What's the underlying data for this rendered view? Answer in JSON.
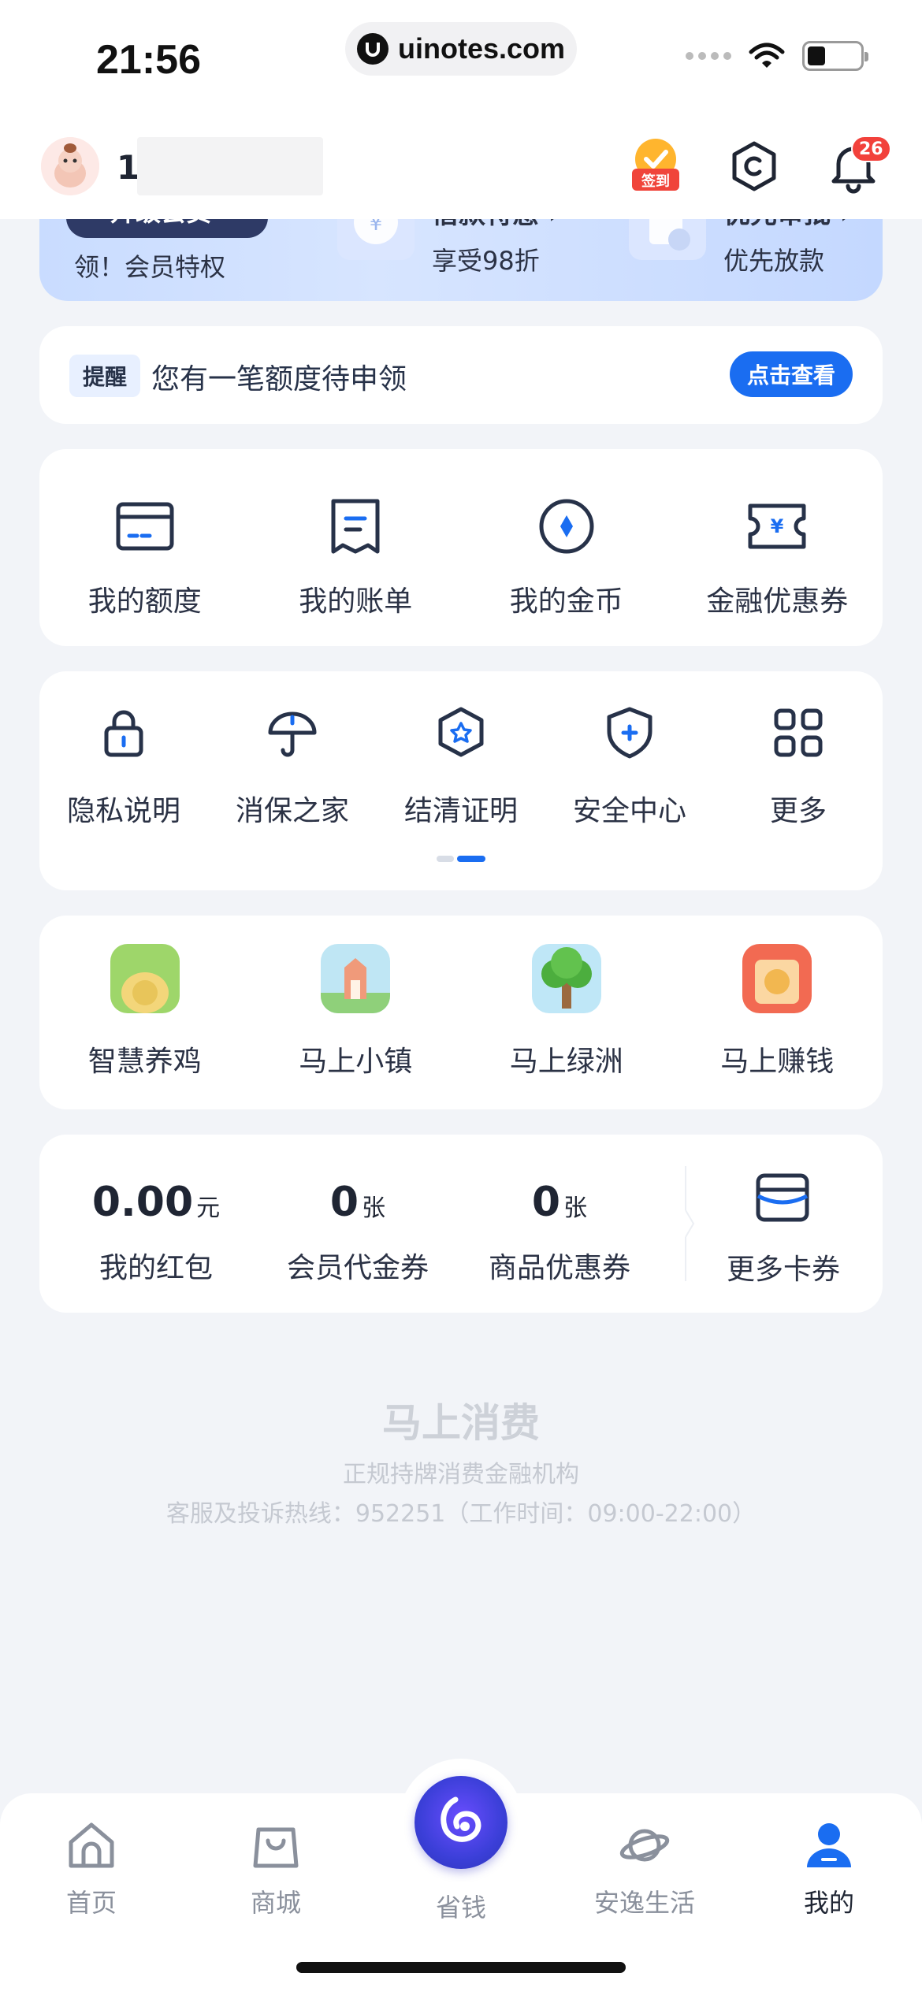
{
  "status_bar": {
    "time": "21:56",
    "url": "uinotes.com"
  },
  "header": {
    "user_name": "1",
    "checkin_label": "签到",
    "notification_count": "26"
  },
  "member_banner": {
    "upgrade_label": "升级会员 ›",
    "item1_sub": "领！会员特权",
    "item2_title": "借款特惠 ›",
    "item2_sub": "享受98折",
    "item3_title": "优先审批 ›",
    "item3_sub": "优先放款"
  },
  "reminder": {
    "tag": "提醒",
    "text": "您有一笔额度待申领",
    "button": "点击查看"
  },
  "finance_grid": [
    {
      "label": "我的额度",
      "icon": "credit-card-icon"
    },
    {
      "label": "我的账单",
      "icon": "bill-icon"
    },
    {
      "label": "我的金币",
      "icon": "coin-icon"
    },
    {
      "label": "金融优惠券",
      "icon": "ticket-icon"
    }
  ],
  "service_grid": [
    {
      "label": "隐私说明",
      "icon": "lock-icon"
    },
    {
      "label": "消保之家",
      "icon": "umbrella-icon"
    },
    {
      "label": "结清证明",
      "icon": "badge-icon"
    },
    {
      "label": "安全中心",
      "icon": "shield-icon"
    },
    {
      "label": "更多",
      "icon": "more-grid-icon"
    }
  ],
  "games": [
    {
      "label": "智慧养鸡"
    },
    {
      "label": "马上小镇"
    },
    {
      "label": "马上绿洲"
    },
    {
      "label": "马上赚钱"
    }
  ],
  "coupons": {
    "red_packet": {
      "value": "0.00",
      "unit": "元",
      "label": "我的红包"
    },
    "member_voucher": {
      "value": "0",
      "unit": "张",
      "label": "会员代金券"
    },
    "goods_coupon": {
      "value": "0",
      "unit": "张",
      "label": "商品优惠券"
    },
    "more_label": "更多卡券"
  },
  "brand": {
    "name": "马上消费",
    "subtitle": "正规持牌消费金融机构",
    "hotline": "客服及投诉热线：952251（工作时间：09:00-22:00）"
  },
  "tabbar": [
    {
      "label": "首页",
      "icon": "home-icon"
    },
    {
      "label": "商城",
      "icon": "bag-icon"
    },
    {
      "label": "省钱",
      "icon": "save-money-icon"
    },
    {
      "label": "安逸生活",
      "icon": "planet-icon"
    },
    {
      "label": "我的",
      "icon": "profile-icon",
      "active": true
    }
  ],
  "colors": {
    "accent": "#1a6df1",
    "badge": "#f2413b",
    "background": "#f2f4f8"
  }
}
